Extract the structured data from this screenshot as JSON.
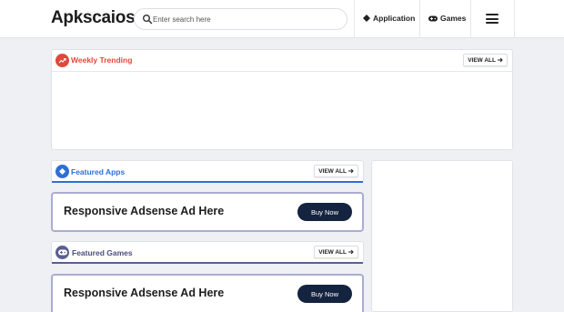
{
  "header": {
    "logo": "Apkscaios",
    "search_placeholder": "Enter search here",
    "nav": [
      {
        "label": "Application",
        "icon": "diamond-icon"
      },
      {
        "label": "Games",
        "icon": "gamepad-icon"
      }
    ],
    "menu_icon": "hamburger-menu-icon"
  },
  "trending": {
    "title": "Weekly Trending",
    "view_all": "VIEW ALL",
    "accent_color": "#e0483b"
  },
  "featured_apps": {
    "title": "Featured Apps",
    "view_all": "VIEW ALL",
    "accent_color": "#2f6fd6"
  },
  "ad_1": {
    "title": "Responsive Adsense Ad Here",
    "button": "Buy Now"
  },
  "featured_games": {
    "title": "Featured Games",
    "view_all": "VIEW ALL",
    "accent_color": "#5a5f8f"
  },
  "ad_2": {
    "title": "Responsive Adsense Ad Here",
    "button": "Buy Now"
  },
  "colors": {
    "button_bg": "#14233f",
    "ad_border": "#a9acd1"
  }
}
